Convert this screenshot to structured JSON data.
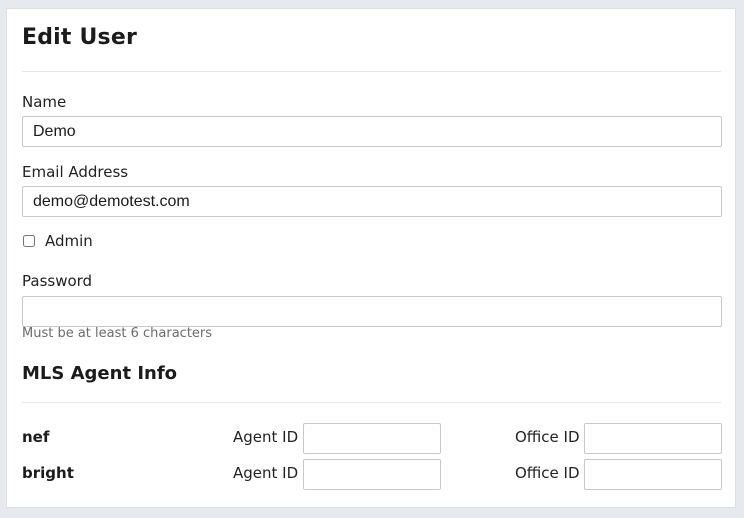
{
  "page": {
    "title": "Edit User"
  },
  "form": {
    "name_label": "Name",
    "name_value": "Demo",
    "email_label": "Email Address",
    "email_value": "demo@demotest.com",
    "admin_label": "Admin",
    "admin_checked": false,
    "password_label": "Password",
    "password_value": "",
    "password_help": "Must be at least 6 characters"
  },
  "mls": {
    "section_title": "MLS Agent Info",
    "rows": [
      {
        "name": "nef",
        "agent_label": "Agent ID",
        "agent_value": "",
        "office_label": "Office ID",
        "office_value": ""
      },
      {
        "name": "bright",
        "agent_label": "Agent ID",
        "agent_value": "",
        "office_label": "Office ID",
        "office_value": ""
      }
    ]
  }
}
